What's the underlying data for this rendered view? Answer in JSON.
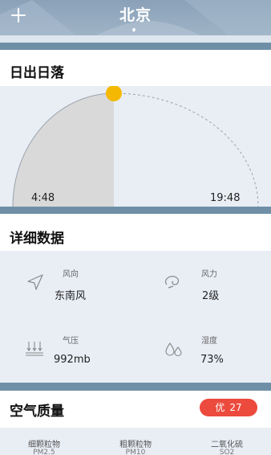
{
  "header": {
    "city": "北京",
    "add_icon": "plus-icon",
    "location_icon": "location-dot-icon"
  },
  "sunrise_section": {
    "title": "日出日落",
    "sunrise_time": "4:48",
    "sunset_time": "19:48",
    "sun_icon": "sun-icon"
  },
  "details_section": {
    "title": "详细数据",
    "items": [
      {
        "label": "风向",
        "value": "东南风",
        "icon": "navigation-arrow-icon"
      },
      {
        "label": "风力",
        "value": "2级",
        "icon": "wind-swirl-icon"
      },
      {
        "label": "气压",
        "value": "992mb",
        "icon": "pressure-gauge-icon"
      },
      {
        "label": "湿度",
        "value": "73%",
        "icon": "humidity-drops-icon"
      }
    ]
  },
  "air_section": {
    "title": "空气质量",
    "badge_level": "优",
    "badge_value": "27",
    "badge_color": "#ec4a3d",
    "pollutants": [
      {
        "name": "细颗粒物",
        "code": "PM2.5"
      },
      {
        "name": "粗颗粒物",
        "code": "PM10"
      },
      {
        "name": "二氧化硫",
        "code": "SO2"
      }
    ]
  },
  "colors": {
    "header": "#9bb0c4",
    "band_dark": "#6f8fa7",
    "card_bg": "#e9eef5",
    "sun": "#f5b800"
  }
}
